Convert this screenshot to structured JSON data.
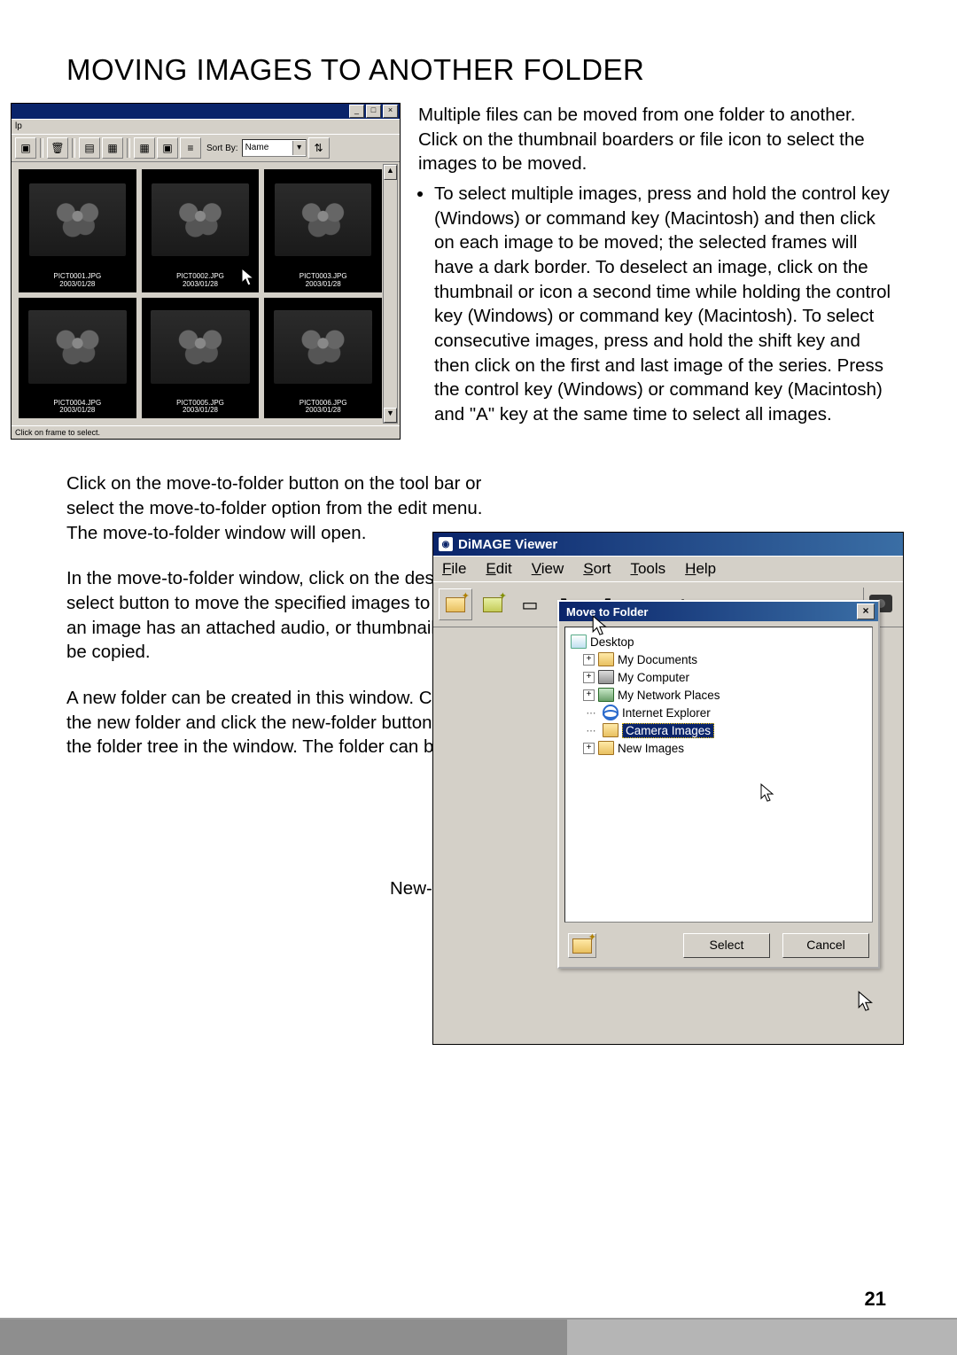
{
  "page_number": "21",
  "section_title": "MOVING IMAGES TO ANOTHER FOLDER",
  "intro_paragraph": "Multiple files can be moved from one folder to another. Click on the thumbnail boarders or file icon to select the images to be moved.",
  "bullet_text": "To select multiple images, press and hold the control key (Windows) or command key (Macintosh) and then click on each image to be moved; the selected frames will have a dark border. To deselect an image, click on the thumbnail or icon a second time while holding the control key (Windows) or command key (Macintosh). To select consecutive images, press and hold the shift key and then click on the first and last image of the series. Press the control key (Windows) or command key (Macintosh) and \"A\" key at the same time to select all images.",
  "mid_paragraph_1": "Click on the move-to-folder button on the tool bar or select the move-to-folder option from the edit menu. The move-to-folder window will open.",
  "mid_paragraph_2": "In the move-to-folder window, click on the destination folder. Click the select button to move the specified images to the designated folder. If an image has an attached audio, or thumbnail file, those files will also be copied.",
  "mid_paragraph_3": "A new folder can be created in this window. Click on the location for the new folder and click the new-folder button; a folder will appear in the folder tree in the window. The folder can be renamed.",
  "new_folder_button_label": "New-folder button",
  "thumb_window": {
    "menu_help": "lp",
    "sort_by_label": "Sort By:",
    "sort_by_value": "Name",
    "status_text": "Click on frame to select.",
    "thumbnails": [
      {
        "filename": "PICT0001.JPG",
        "date": "2003/01/28",
        "selected": true
      },
      {
        "filename": "PICT0002.JPG",
        "date": "2003/01/28",
        "selected": true
      },
      {
        "filename": "PICT0003.JPG",
        "date": "2003/01/28",
        "selected": true
      },
      {
        "filename": "PICT0004.JPG",
        "date": "2003/01/28",
        "selected": false
      },
      {
        "filename": "PICT0005.JPG",
        "date": "2003/01/28",
        "selected": false
      },
      {
        "filename": "PICT0006.JPG",
        "date": "2003/01/28",
        "selected": false
      }
    ]
  },
  "viewer_window": {
    "title": "DiMAGE Viewer",
    "menus": {
      "file": "File",
      "edit": "Edit",
      "view": "View",
      "sort": "Sort",
      "tools": "Tools",
      "help": "Help"
    }
  },
  "move_dialog": {
    "title": "Move to Folder",
    "select_button": "Select",
    "cancel_button": "Cancel",
    "tree": {
      "root": "Desktop",
      "items": [
        {
          "label": "My Documents",
          "expandable": true
        },
        {
          "label": "My Computer",
          "expandable": true
        },
        {
          "label": "My Network Places",
          "expandable": true
        },
        {
          "label": "Internet Explorer",
          "expandable": false
        },
        {
          "label": "Camera Images",
          "expandable": false,
          "selected": true
        },
        {
          "label": "New Images",
          "expandable": true
        }
      ]
    }
  }
}
